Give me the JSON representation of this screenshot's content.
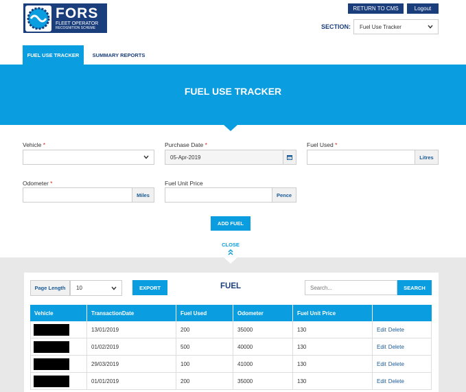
{
  "header": {
    "logo_text": "FORS",
    "logo_sub1": "FLEET OPERATOR",
    "logo_sub2": "RECOGNITION SCHEME",
    "return_button": "RETURN TO CMS",
    "logout_button": "Logout",
    "section_label": "SECTION:",
    "section_value": "Fuel Use Tracker"
  },
  "tabs": [
    {
      "label": "FUEL USE TRACKER",
      "active": true
    },
    {
      "label": "SUMMARY REPORTS",
      "active": false
    }
  ],
  "banner": {
    "title": "FUEL USE TRACKER"
  },
  "form": {
    "vehicle": {
      "label": "Vehicle",
      "value": ""
    },
    "purchase_date": {
      "label": "Purchase Date",
      "value": "05-Apr-2019"
    },
    "fuel_used": {
      "label": "Fuel Used",
      "value": "",
      "unit": "Litres"
    },
    "odometer": {
      "label": "Odometer",
      "value": "",
      "unit": "Miles"
    },
    "fuel_unit_price": {
      "label": "Fuel Unit Price",
      "value": "",
      "unit": "Pence"
    },
    "required_marker": "*",
    "add_button": "ADD FUEL",
    "close_label": "CLOSE"
  },
  "table_panel": {
    "page_length_label": "Page Length",
    "page_length_value": "10",
    "export_button": "EXPORT",
    "title": "FUEL",
    "search_placeholder": "Search...",
    "search_button": "SEARCH",
    "columns": [
      "Vehicle",
      "TransactionDate",
      "Fuel Used",
      "Odometer",
      "Fuel Unit Price",
      ""
    ],
    "rows": [
      {
        "date": "13/01/2019",
        "fuel": "200",
        "odometer": "35000",
        "price": "130",
        "edit": "Edit",
        "delete": "Delete"
      },
      {
        "date": "01/02/2019",
        "fuel": "500",
        "odometer": "40000",
        "price": "130",
        "edit": "Edit",
        "delete": "Delete"
      },
      {
        "date": "29/03/2019",
        "fuel": "100",
        "odometer": "41000",
        "price": "130",
        "edit": "Edit",
        "delete": "Delete"
      },
      {
        "date": "01/01/2019",
        "fuel": "200",
        "odometer": "35000",
        "price": "130",
        "edit": "Edit",
        "delete": "Delete"
      }
    ]
  },
  "colors": {
    "primary_blue": "#0a9de0",
    "navy": "#1a3d7c",
    "required_red": "#e0261f",
    "grey_background": "#e8e8e8"
  },
  "icons": {
    "logo": "fors-logo-icon",
    "dropdown": "chevron-down-icon",
    "calendar": "calendar-icon",
    "collapse": "double-chevron-up-icon"
  }
}
